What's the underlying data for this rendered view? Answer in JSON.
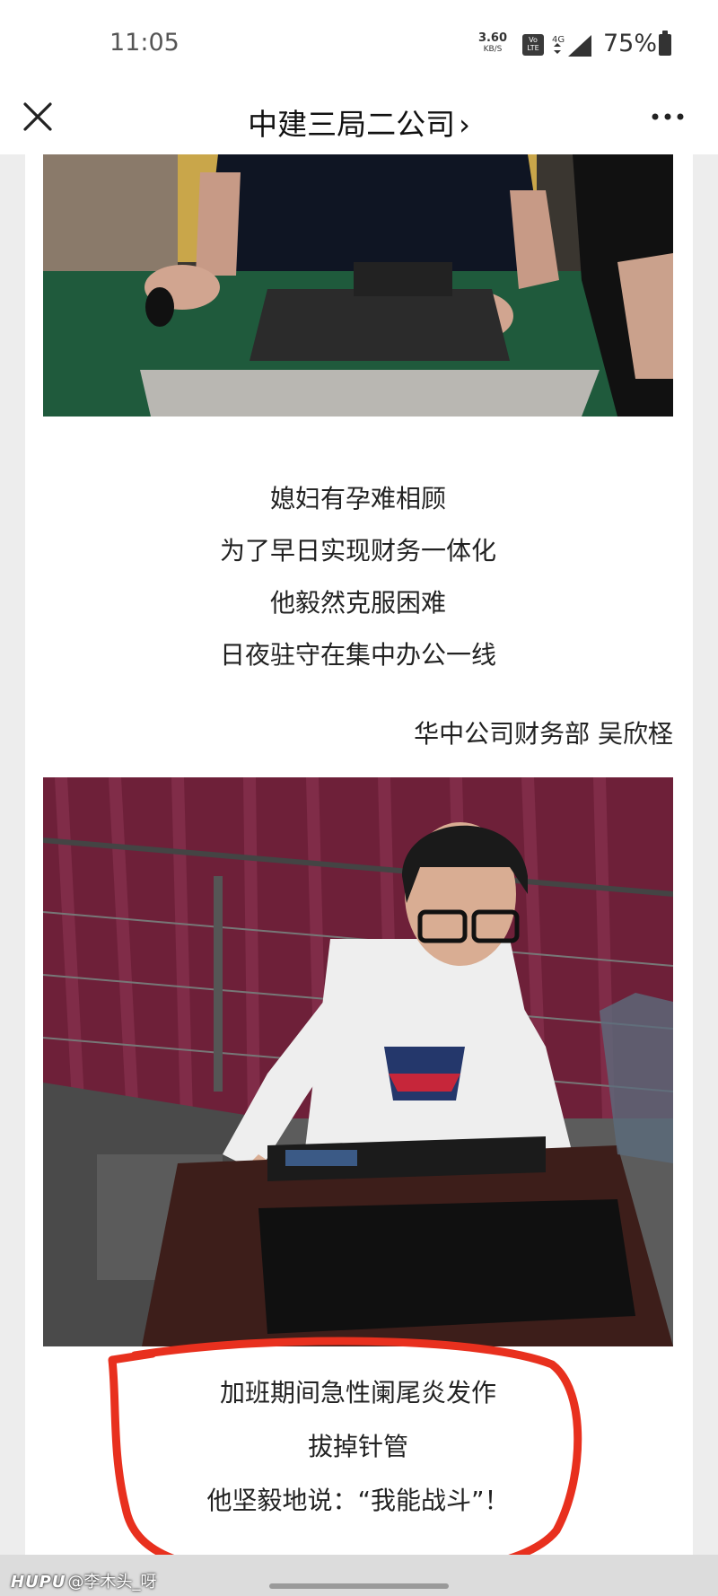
{
  "status_bar": {
    "time": "11:05",
    "net_speed": "3.60",
    "net_unit": "KB/S",
    "volte": "Vo LTE",
    "network": "4G",
    "battery": "75%"
  },
  "nav": {
    "title": "中建三局二公司",
    "chevron": "›"
  },
  "article": {
    "caption1": [
      "媳妇有孕难相顾",
      "为了早日实现财务一体化",
      "他毅然克服困难",
      "日夜驻守在集中办公一线"
    ],
    "signature": "华中公司财务部  吴欣柽",
    "caption2": [
      "加班期间急性阑尾炎发作",
      "拔掉针管",
      "他坚毅地说：“我能战斗”！"
    ]
  },
  "watermark": {
    "brand": "HUPU",
    "user": "@李木头_呀"
  },
  "colors": {
    "annotation": "#e8301e",
    "background": "#ededed"
  }
}
